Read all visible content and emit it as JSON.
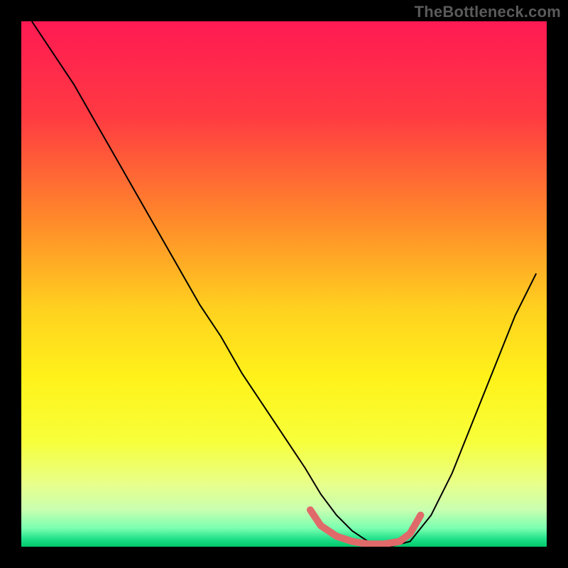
{
  "watermark": "TheBottleneck.com",
  "chart_data": {
    "type": "line",
    "title": "",
    "xlabel": "",
    "ylabel": "",
    "xlim": [
      0,
      100
    ],
    "ylim": [
      0,
      100
    ],
    "grid": false,
    "legend": false,
    "background_gradient_stops": [
      {
        "offset": 0.0,
        "color": "#ff1a53"
      },
      {
        "offset": 0.18,
        "color": "#ff3a42"
      },
      {
        "offset": 0.38,
        "color": "#ff8a2a"
      },
      {
        "offset": 0.55,
        "color": "#ffd21f"
      },
      {
        "offset": 0.68,
        "color": "#fff21a"
      },
      {
        "offset": 0.8,
        "color": "#f7ff3a"
      },
      {
        "offset": 0.88,
        "color": "#e8ff8a"
      },
      {
        "offset": 0.93,
        "color": "#c8ffb0"
      },
      {
        "offset": 0.965,
        "color": "#7affb0"
      },
      {
        "offset": 0.985,
        "color": "#22e08a"
      },
      {
        "offset": 1.0,
        "color": "#00c86a"
      }
    ],
    "series": [
      {
        "name": "bottleneck-curve",
        "stroke": "#000000",
        "stroke_width": 2,
        "x": [
          2,
          6,
          10,
          14,
          18,
          22,
          26,
          30,
          34,
          38,
          42,
          46,
          50,
          54,
          57,
          60,
          63,
          66,
          70,
          74,
          78,
          82,
          86,
          90,
          94,
          98
        ],
        "y": [
          100,
          94,
          88,
          81,
          74,
          67,
          60,
          53,
          46,
          40,
          33,
          27,
          21,
          15,
          10,
          6,
          3,
          1,
          0,
          1,
          6,
          14,
          24,
          34,
          44,
          52
        ]
      }
    ],
    "highlight": {
      "name": "optimal-range",
      "stroke": "#e06a6a",
      "stroke_width": 10,
      "points_x": [
        55,
        57,
        60,
        63,
        66,
        69,
        72,
        74,
        76
      ],
      "points_y": [
        7,
        4,
        2,
        1,
        0.5,
        0.5,
        1,
        2.5,
        6
      ]
    }
  }
}
